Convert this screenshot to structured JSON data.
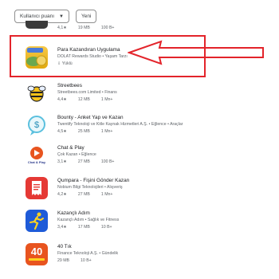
{
  "filters": {
    "rating_label": "Kullanıcı puanı",
    "new_label": "Yeni"
  },
  "top_item": {
    "rating": "4,1★",
    "size": "19 MB",
    "downloads": "100 B+"
  },
  "apps": [
    {
      "title": "Para Kazandıran Uygulama",
      "sub": "DOLAT Rewards Studio • Yaşam Tarzı",
      "rating": "",
      "size": "",
      "downloads": "",
      "installed": "Yüklü",
      "icon": "money-icon"
    },
    {
      "title": "Streetbees",
      "sub": "Streetbees.com Limited • Finans",
      "rating": "4,4★",
      "size": "12 MB",
      "downloads": "1 Mn+",
      "icon": "bee-icon"
    },
    {
      "title": "Bounty - Anket Yap ve Kazan",
      "sub": "Twentify Teknoloji ve Kitle Kaynak Hizmetleri A.Ş. • Eğlence • Araçlar",
      "rating": "4,5★",
      "size": "25 MB",
      "downloads": "1 Mn+",
      "icon": "dollar-bubble-icon"
    },
    {
      "title": "Chat & Play",
      "sub": "Çok Kazan • Eğlence",
      "rating": "3,1★",
      "size": "27 MB",
      "downloads": "100 B+",
      "icon": "chat-play-icon",
      "icon_text": "Chat & Play"
    },
    {
      "title": "Qumpara - Fişini Gönder Kazan",
      "sub": "Nobium Bilgi Teknolojileri • Alışveriş",
      "rating": "4,2★",
      "size": "27 MB",
      "downloads": "1 Mn+",
      "icon": "receipt-icon"
    },
    {
      "title": "Kazançlı Adım",
      "sub": "Kazançlı Adım • Sağlık ve Fitness",
      "rating": "3,4★",
      "size": "17 MB",
      "downloads": "10 B+",
      "icon": "runner-icon"
    },
    {
      "title": "40 Tık",
      "sub": "Finance Teknoloji A.Ş. • Gündelik",
      "rating": "",
      "size": "29 MB",
      "downloads": "10 B+",
      "icon": "forty-tik-icon",
      "icon_text": "40"
    }
  ],
  "colors": {
    "highlight": "#e3242b",
    "accent": "#1a73e8"
  }
}
